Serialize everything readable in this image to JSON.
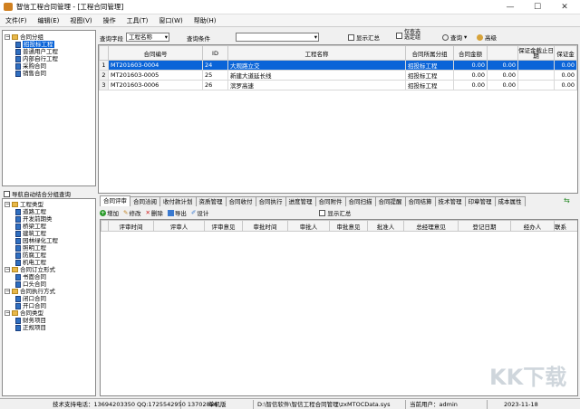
{
  "window": {
    "title": "智信工程合同管理 - [工程合同管理]",
    "min": "—",
    "max": "☐",
    "close": "✕"
  },
  "menu": [
    "文件(F)",
    "编辑(E)",
    "视图(V)",
    "操作",
    "工具(T)",
    "窗口(W)",
    "帮助(H)"
  ],
  "tree_top": {
    "root": "合同分组",
    "items": [
      "招投标工程",
      "普通用户工程",
      "内部自行工程",
      "采购合同",
      "销售合同"
    ]
  },
  "nav_option": "导航自动结合分组查询",
  "tree_bottom": [
    {
      "label": "工程类型",
      "children": [
        "道路工程",
        "开发前期类",
        "桥梁工程",
        "建筑工程",
        "园林绿化工程",
        "照明工程",
        "防腐工程",
        "机电工程"
      ]
    },
    {
      "label": "合同订立形式",
      "children": [
        "书面合同",
        "口头合同"
      ]
    },
    {
      "label": "合同执行方式",
      "children": [
        "闭口合同",
        "开口合同"
      ]
    },
    {
      "label": "合同类型",
      "children": [
        "财务项目",
        "正规项目"
      ]
    }
  ],
  "query": {
    "field_label": "查询字段",
    "field_value": "工程名称",
    "cond_label": "查询条件",
    "cond_value": "",
    "show_summary": "显示汇总",
    "only_selected": "仅查选\n选定组",
    "search": "查询",
    "advanced": "高级"
  },
  "contracts": {
    "columns": [
      "合同编号",
      "ID",
      "工程名称",
      "合同所属分组",
      "合同金额",
      "审定金额",
      "保证金截止日期",
      "保证金"
    ],
    "rows": [
      {
        "n": "1",
        "code": "MT201603-0004",
        "id": "24",
        "name": "大观路立交",
        "group": "招投标工程",
        "amount": "0.00",
        "approved": "0.00",
        "date": "",
        "deposit": "0.00"
      },
      {
        "n": "2",
        "code": "MT201603-0005",
        "id": "25",
        "name": "新建大道延长线",
        "group": "招投标工程",
        "amount": "0.00",
        "approved": "0.00",
        "date": "",
        "deposit": "0.00"
      },
      {
        "n": "3",
        "code": "MT201603-0006",
        "id": "26",
        "name": "滨罗高速",
        "group": "招投标工程",
        "amount": "0.00",
        "approved": "0.00",
        "date": "",
        "deposit": "0.00"
      }
    ]
  },
  "tabs": [
    "合同评审",
    "合同洽阅",
    "收付款计划",
    "资质管理",
    "合同收付",
    "合同执行",
    "进度管理",
    "合同附件",
    "合同扫描",
    "合同提醒",
    "合同结算",
    "技术管理",
    "印章管理",
    "成本属性"
  ],
  "actions": {
    "add": "增加",
    "edit": "修改",
    "delete": "删除",
    "export": "导出",
    "design": "设计",
    "show_summary": "显示汇总"
  },
  "review": {
    "columns": [
      "评审时间",
      "评审人",
      "评审意见",
      "审批时间",
      "审批人",
      "审批意见",
      "批准人",
      "总经理意见",
      "登记日期",
      "经办人",
      "联系"
    ]
  },
  "status": {
    "support": "技术支持电话：13694203350 QQ:1725542950 13702856",
    "mode": "单机版",
    "path": "D:\\智信软件\\智信工程合同管理\\zxMTOCData.sys",
    "user": "当前用户：admin",
    "date": "2023-11-18"
  },
  "watermark": "KK下载",
  "colors": {
    "selection": "#0a64d8",
    "folder": "#e8b84a",
    "doc": "#2f6fc0"
  }
}
